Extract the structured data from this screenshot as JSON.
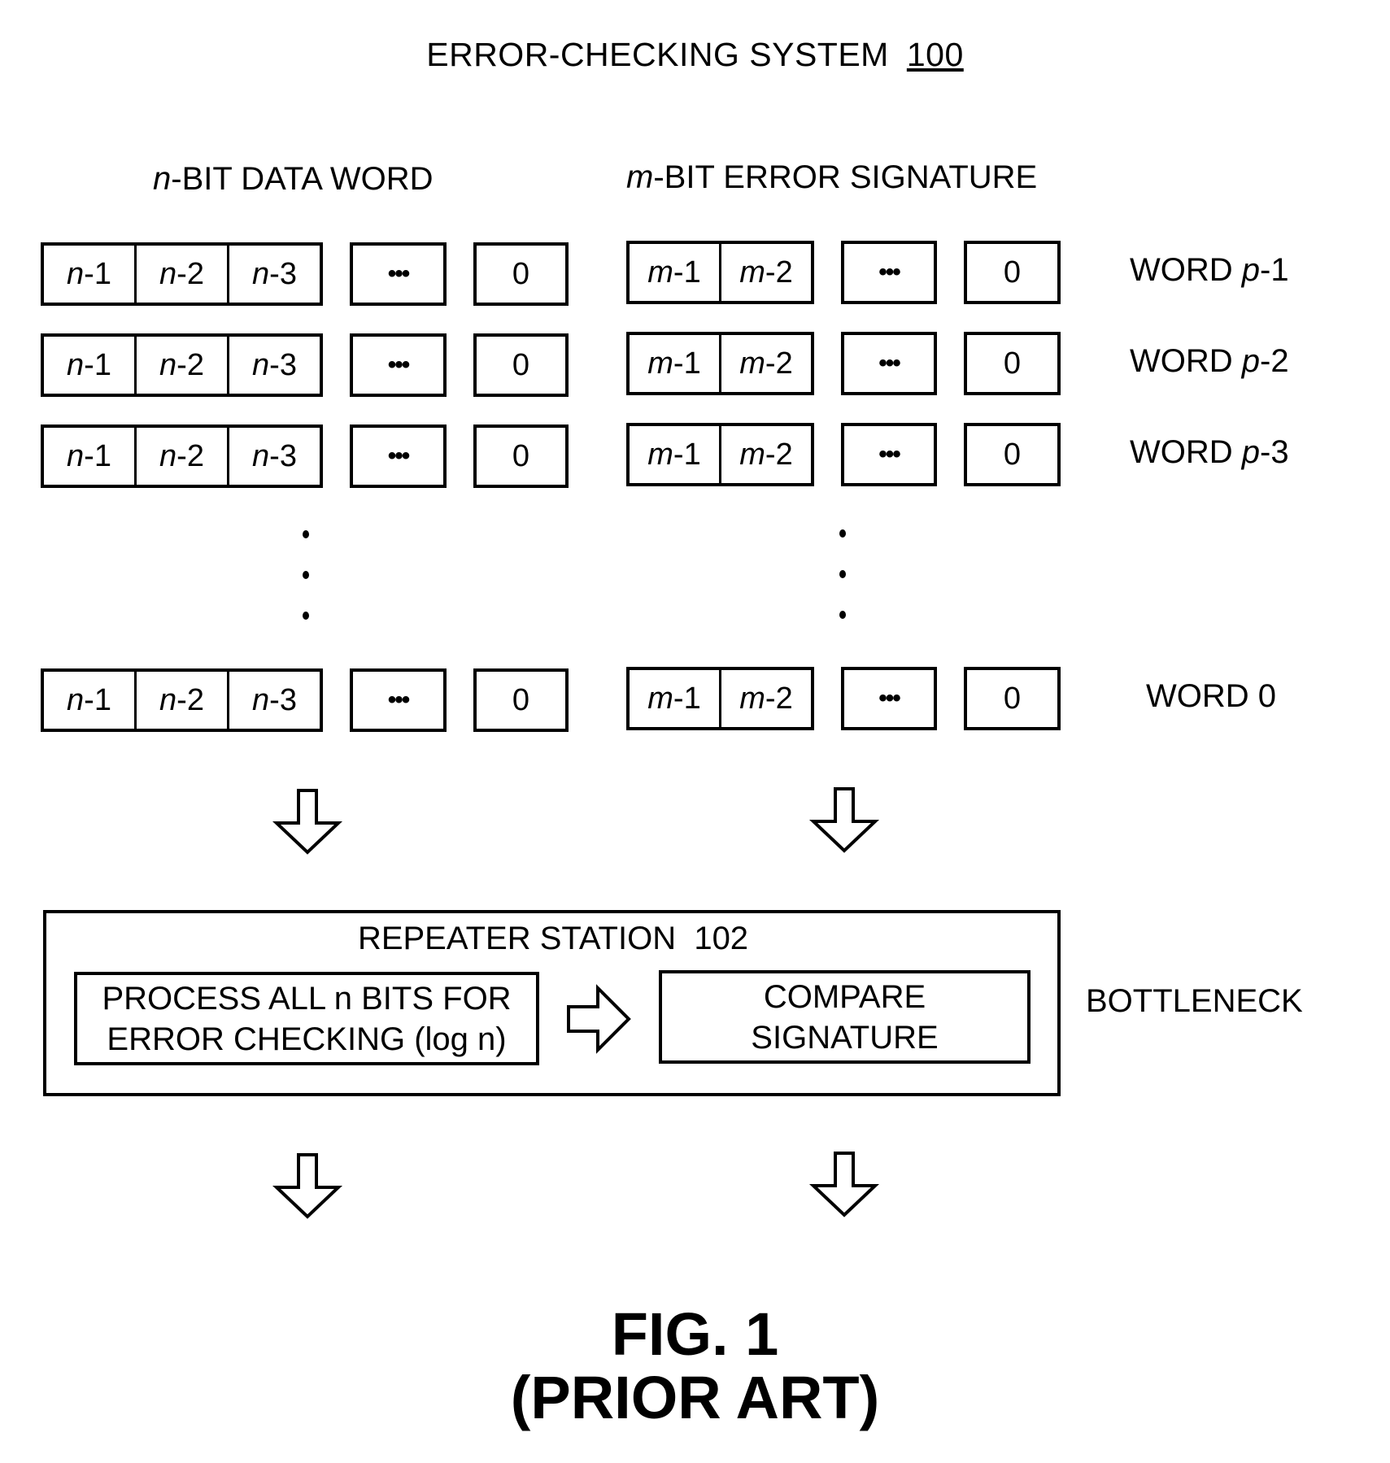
{
  "title": {
    "text": "ERROR-CHECKING SYSTEM",
    "ref": "100"
  },
  "headers": {
    "data_word": {
      "var": "n",
      "rest": "-BIT DATA WORD"
    },
    "signature": {
      "var": "m",
      "rest": "-BIT ERROR SIGNATURE"
    }
  },
  "cells": {
    "n1": {
      "var": "n",
      "suffix": "-1"
    },
    "n2": {
      "var": "n",
      "suffix": "-2"
    },
    "n3": {
      "var": "n",
      "suffix": "-3"
    },
    "m1": {
      "var": "m",
      "suffix": "-1"
    },
    "m2": {
      "var": "m",
      "suffix": "-2"
    },
    "ellipsis": "•••",
    "zero": "0"
  },
  "words": [
    {
      "prefix": "WORD ",
      "var": "p",
      "suffix": "-1"
    },
    {
      "prefix": "WORD ",
      "var": "p",
      "suffix": "-2"
    },
    {
      "prefix": "WORD ",
      "var": "p",
      "suffix": "-3"
    },
    {
      "prefix": "WORD 0",
      "var": "",
      "suffix": ""
    }
  ],
  "repeater": {
    "title": "REPEATER STATION  102",
    "process_line1": "PROCESS ALL n BITS FOR",
    "process_line2": "ERROR CHECKING (log n)",
    "compare_line1": "COMPARE",
    "compare_line2": "SIGNATURE"
  },
  "bottleneck": "BOTTLENECK",
  "figure": {
    "label": "FIG. 1",
    "note": "(PRIOR ART)"
  }
}
